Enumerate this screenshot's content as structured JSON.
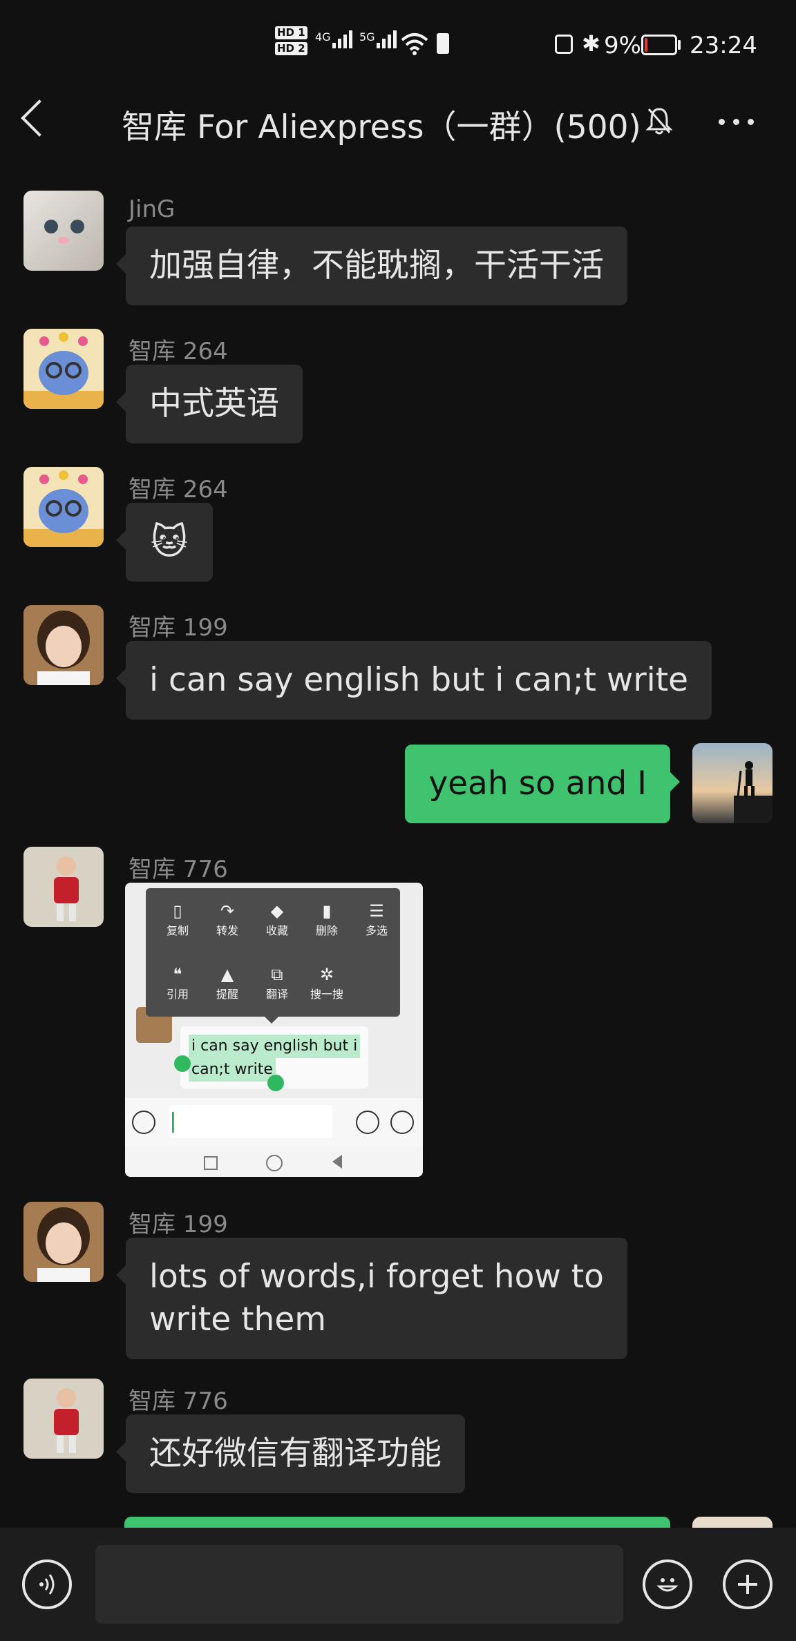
{
  "status_bar": {
    "hd1": "HD 1",
    "hd2": "HD 2",
    "net1": "4G",
    "net2": "5G",
    "battery_percent": "9%",
    "battery_level": 0.09,
    "time": "23:24"
  },
  "header": {
    "title": "智库 For Aliexpress（一群）(500)",
    "muted_icon": "bell-off-icon",
    "more_icon": "more-icon"
  },
  "messages": [
    {
      "sender": "JinG",
      "text": "加强自律，不能耽搁，干活干活"
    },
    {
      "sender": "智库 264",
      "text": "中式英语"
    },
    {
      "sender": "智库 264",
      "emoji": "🐱"
    },
    {
      "sender": "智库 199",
      "text": "i can say english  but i can;t write"
    },
    {
      "sender": "me",
      "text": "yeah so and I"
    },
    {
      "sender": "智库 776",
      "image": "screenshot"
    },
    {
      "sender": "智库 199",
      "text_line1": "lots of words,i forget how to",
      "text_line2": "write them"
    },
    {
      "sender": "智库 776",
      "text": "还好微信有翻译功能"
    }
  ],
  "screenshot": {
    "menu_items": [
      "复制",
      "转发",
      "收藏",
      "删除",
      "多选",
      "引用",
      "提醒",
      "翻译",
      "搜一搜"
    ],
    "selected_line1": "i can say english  but i",
    "selected_line2": "can;t write"
  },
  "colors": {
    "background": "#111111",
    "bubble_other": "#2c2c2c",
    "bubble_mine": "#3fc36f",
    "battery_low": "#e53935"
  }
}
